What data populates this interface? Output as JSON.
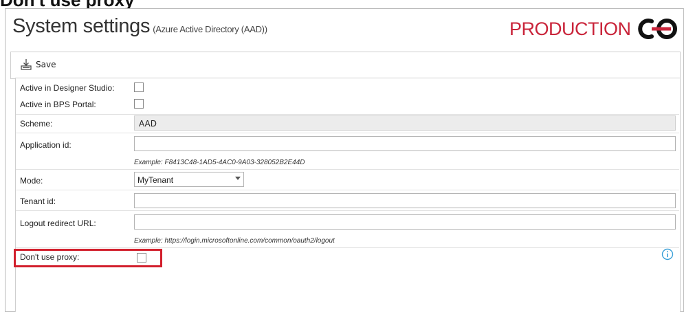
{
  "cut_heading": "Don't use proxy",
  "window": {
    "title": "System settings",
    "subtitle": "(Azure Active Directory (AAD))",
    "environment": "PRODUCTION",
    "brand_color": "#c9243a"
  },
  "toolbar": {
    "save_label": "Save",
    "save_icon": "save-icon"
  },
  "form": {
    "active_designer_label": "Active in Designer Studio:",
    "active_designer_checked": false,
    "active_bps_label": "Active in BPS Portal:",
    "active_bps_checked": false,
    "scheme_label": "Scheme:",
    "scheme_value": "AAD",
    "application_id_label": "Application id:",
    "application_id_value": "",
    "application_id_example": "Example: F8413C48-1AD5-4AC0-9A03-328052B2E44D",
    "mode_label": "Mode:",
    "mode_value": "MyTenant",
    "tenant_id_label": "Tenant id:",
    "tenant_id_value": "",
    "logout_label": "Logout redirect URL:",
    "logout_value": "",
    "logout_example": "Example: https://login.microsoftonline.com/common/oauth2/logout",
    "proxy_label": "Don't use proxy:",
    "proxy_checked": false,
    "highlight_color": "#d21f2c",
    "info_icon": "info-icon",
    "info_color": "#3aa0d8"
  }
}
